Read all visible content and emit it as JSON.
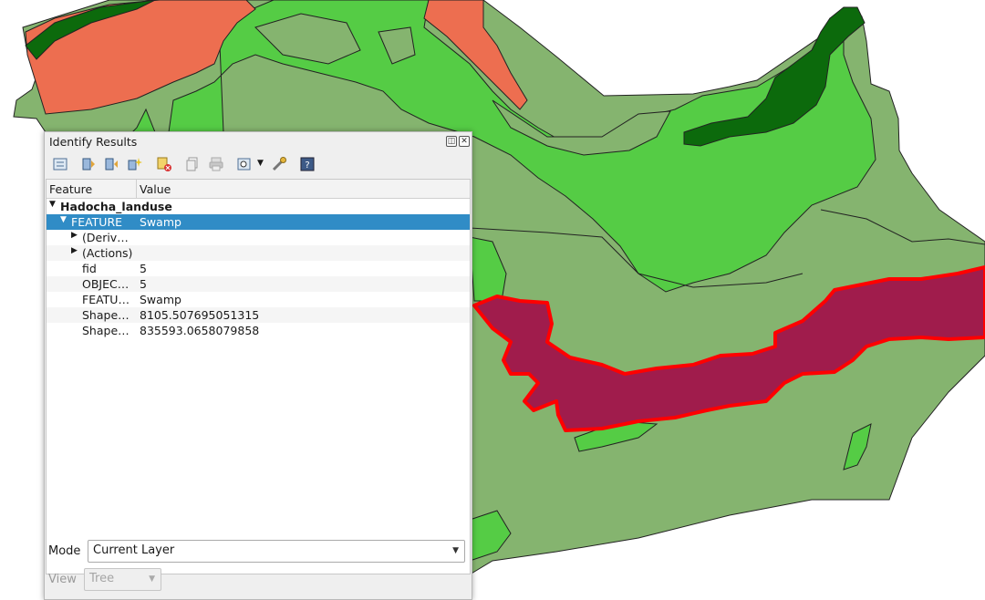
{
  "window_title": "Identify Results",
  "columns": {
    "feature": "Feature",
    "value": "Value"
  },
  "layer_name": "Hadocha_landuse",
  "feature_row": {
    "label": "FEATURE",
    "value": "Swamp"
  },
  "derived_label": "(Deriv…",
  "actions_label": "(Actions)",
  "attributes": [
    {
      "name": "fid",
      "value": "5"
    },
    {
      "name": "OBJEC…",
      "value": "5"
    },
    {
      "name": "FEATU…",
      "value": "Swamp"
    },
    {
      "name": "Shape…",
      "value": "8105.507695051315"
    },
    {
      "name": "Shape…",
      "value": "835593.0658079858"
    }
  ],
  "mode_label": "Mode",
  "mode_value": "Current Layer",
  "view_label": "View",
  "view_value": "Tree",
  "icons": [
    "expand-tree-icon",
    "expand-all-icon",
    "collapse-all-icon",
    "expand-new-icon",
    "clear-results-icon",
    "copy-feature-icon",
    "print-icon",
    "select-mode-icon",
    "settings-icon",
    "help-icon"
  ],
  "colors": {
    "light_green": "#85b46f",
    "bright_green": "#55cc45",
    "dark_green": "#0c6a0c",
    "orange": "#ed6e50",
    "swamp": "#a01c4c",
    "selection_outline": "#ff0000",
    "selected_row": "#308cc6"
  }
}
